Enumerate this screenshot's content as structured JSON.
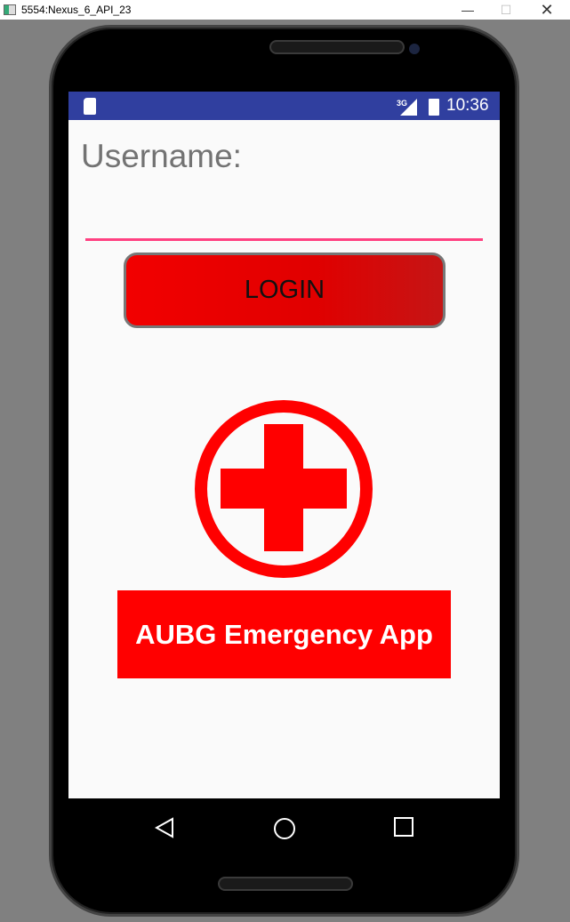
{
  "window": {
    "title": "5554:Nexus_6_API_23"
  },
  "status_bar": {
    "network": "3G",
    "time": "10:36"
  },
  "form": {
    "username_label": "Username:",
    "username_value": "",
    "login_label": "LOGIN"
  },
  "banner": {
    "text": "AUBG Emergency App"
  },
  "colors": {
    "accent": "#ff4081",
    "primary": "#303f9f",
    "red": "#ff0000"
  }
}
